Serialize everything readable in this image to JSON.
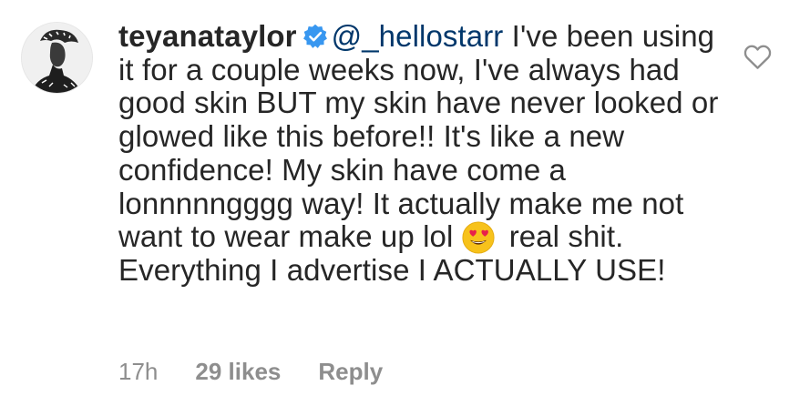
{
  "comment": {
    "username": "teyanataylor",
    "mention": "@_hellostarr",
    "text_part1": " I've been using it for a couple weeks now, I've always had good skin BUT my skin have never looked or glowed like this before!! It's like a new confidence! My skin have come a lonnnnngggg way! It actually make me not want to wear make up lol ",
    "emoji": "smiling-face-with-heart-eyes",
    "text_part2": "real shit. Everything I advertise I ACTUALLY USE!",
    "time": "17h",
    "likes": "29 likes",
    "reply_label": "Reply"
  },
  "icons": {
    "verified": "verified-badge-icon",
    "like": "heart-outline-icon"
  },
  "colors": {
    "text": "#262626",
    "mention": "#00376b",
    "secondary": "#8e8e8e",
    "verified": "#3897f0"
  }
}
